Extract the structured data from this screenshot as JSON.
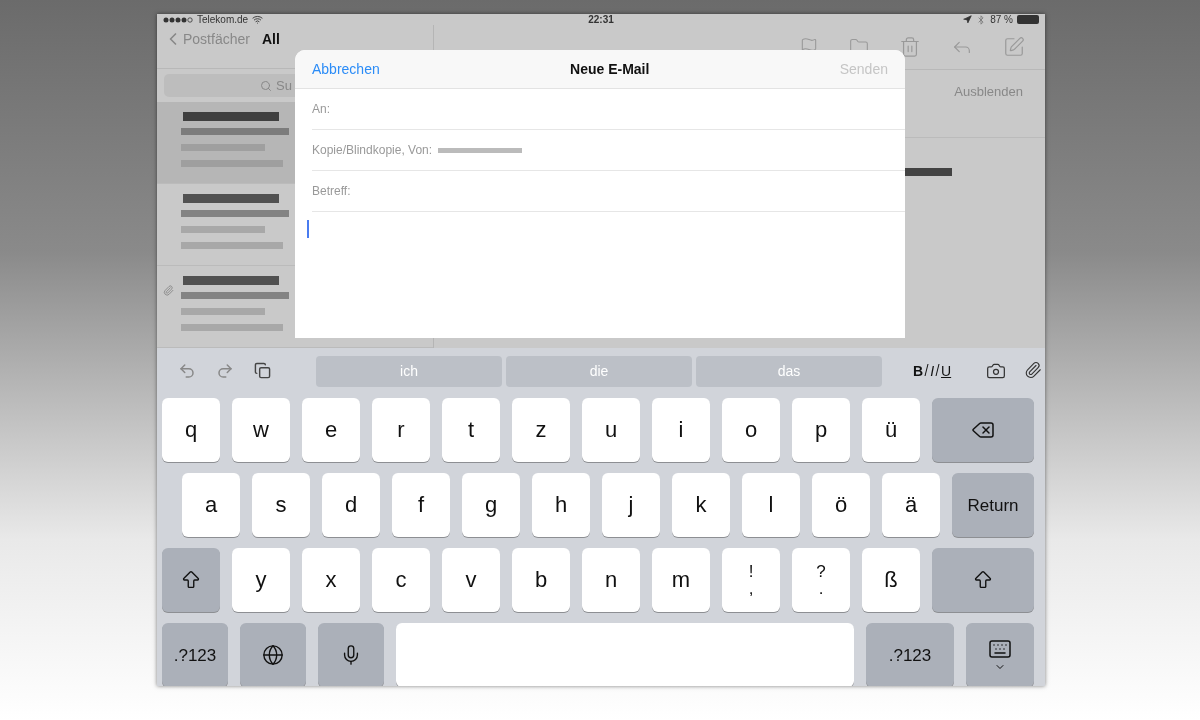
{
  "status_bar": {
    "carrier": "Telekom.de",
    "time": "22:31",
    "battery": "87 %"
  },
  "mailbox": {
    "back": "Postfächer",
    "title": "All",
    "search": {
      "placeholder": "Su"
    },
    "messages": [
      {
        "selected": true,
        "attachment": false
      },
      {
        "selected": false,
        "attachment": false
      },
      {
        "selected": false,
        "attachment": true
      }
    ]
  },
  "reader": {
    "hide": "Ausblenden"
  },
  "compose": {
    "cancel": "Abbrechen",
    "title": "Neue E-Mail",
    "send": {
      "label": "Senden",
      "disabled": true
    },
    "fields": [
      {
        "label": "An:"
      },
      {
        "label": "Kopie/Blindkopie, Von:",
        "value_hidden": true
      },
      {
        "label": "Betreff:"
      }
    ]
  },
  "keyboard": {
    "suggestions": [
      "ich",
      "die",
      "das"
    ],
    "format": [
      "B",
      "I",
      "U"
    ],
    "rows": [
      [
        {
          "kind": "letter",
          "label": "q"
        },
        {
          "kind": "letter",
          "label": "w"
        },
        {
          "kind": "letter",
          "label": "e"
        },
        {
          "kind": "letter",
          "label": "r"
        },
        {
          "kind": "letter",
          "label": "t"
        },
        {
          "kind": "letter",
          "label": "z"
        },
        {
          "kind": "letter",
          "label": "u"
        },
        {
          "kind": "letter",
          "label": "i"
        },
        {
          "kind": "letter",
          "label": "o"
        },
        {
          "kind": "letter",
          "label": "p"
        },
        {
          "kind": "letter",
          "label": "ü"
        },
        {
          "kind": "backspace"
        }
      ],
      [
        {
          "kind": "letter",
          "label": "a"
        },
        {
          "kind": "letter",
          "label": "s"
        },
        {
          "kind": "letter",
          "label": "d"
        },
        {
          "kind": "letter",
          "label": "f"
        },
        {
          "kind": "letter",
          "label": "g"
        },
        {
          "kind": "letter",
          "label": "h"
        },
        {
          "kind": "letter",
          "label": "j"
        },
        {
          "kind": "letter",
          "label": "k"
        },
        {
          "kind": "letter",
          "label": "l"
        },
        {
          "kind": "letter",
          "label": "ö"
        },
        {
          "kind": "letter",
          "label": "ä"
        },
        {
          "kind": "return",
          "label": "Return"
        }
      ],
      [
        {
          "kind": "shift"
        },
        {
          "kind": "letter",
          "label": "y"
        },
        {
          "kind": "letter",
          "label": "x"
        },
        {
          "kind": "letter",
          "label": "c"
        },
        {
          "kind": "letter",
          "label": "v"
        },
        {
          "kind": "letter",
          "label": "b"
        },
        {
          "kind": "letter",
          "label": "n"
        },
        {
          "kind": "letter",
          "label": "m"
        },
        {
          "kind": "punct",
          "label": "!",
          "alt": ","
        },
        {
          "kind": "punct",
          "label": "?",
          "alt": "."
        },
        {
          "kind": "letter",
          "label": "ß"
        },
        {
          "kind": "shift"
        }
      ],
      [
        {
          "kind": "numbers",
          "label": ".?123"
        },
        {
          "kind": "globe"
        },
        {
          "kind": "mic"
        },
        {
          "kind": "space"
        },
        {
          "kind": "numbers",
          "label": ".?123"
        },
        {
          "kind": "hide"
        }
      ]
    ]
  }
}
